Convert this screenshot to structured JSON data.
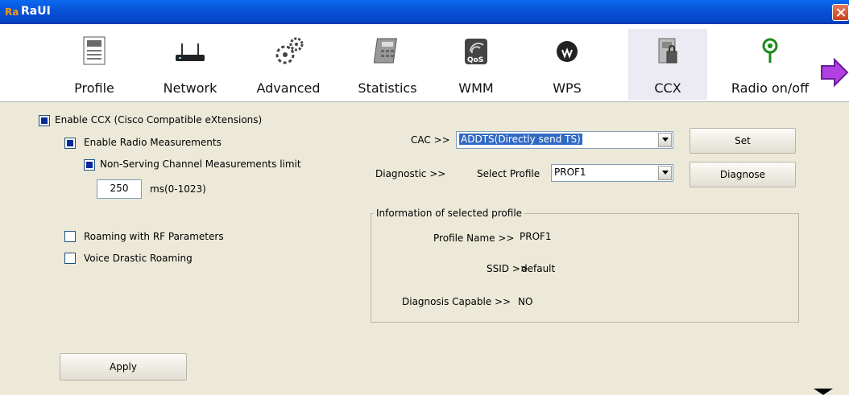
{
  "window": {
    "title": "RaUI",
    "logo": "Ra"
  },
  "toolbar": {
    "items": [
      {
        "label": "Profile",
        "icon": "profile-icon"
      },
      {
        "label": "Network",
        "icon": "network-icon"
      },
      {
        "label": "Advanced",
        "icon": "advanced-icon"
      },
      {
        "label": "Statistics",
        "icon": "statistics-icon"
      },
      {
        "label": "WMM",
        "icon": "wmm-qos-icon"
      },
      {
        "label": "WPS",
        "icon": "wps-icon"
      },
      {
        "label": "CCX",
        "icon": "ccx-icon",
        "selected": true
      },
      {
        "label": "Radio on/off",
        "icon": "radio-icon"
      }
    ]
  },
  "ccx": {
    "enable_ccx": {
      "label": "Enable CCX (Cisco Compatible eXtensions)",
      "checked": true
    },
    "radio_measurements": {
      "label": "Enable Radio Measurements",
      "checked": true
    },
    "non_serving": {
      "label": "Non-Serving Channel Measurements limit",
      "checked": true
    },
    "limit_value": "250",
    "limit_unit": "ms(0-1023)",
    "roaming_rf": {
      "label": "Roaming with RF Parameters",
      "checked": false
    },
    "voice_roaming": {
      "label": "Voice Drastic Roaming",
      "checked": false
    },
    "apply_label": "Apply",
    "cac_label": "CAC >>",
    "cac_value": "ADDTS(Directly send TS)",
    "set_label": "Set",
    "diagnostic_label": "Diagnostic >>",
    "select_profile_label": "Select Profile",
    "select_profile_value": "PROF1",
    "diagnose_label": "Diagnose",
    "info": {
      "title": "Information of selected profile",
      "profile_name_label": "Profile Name >>",
      "profile_name_value": "PROF1",
      "ssid_label": "SSID >>",
      "ssid_value": "default",
      "diag_capable_label": "Diagnosis Capable >>",
      "diag_capable_value": "NO"
    }
  }
}
